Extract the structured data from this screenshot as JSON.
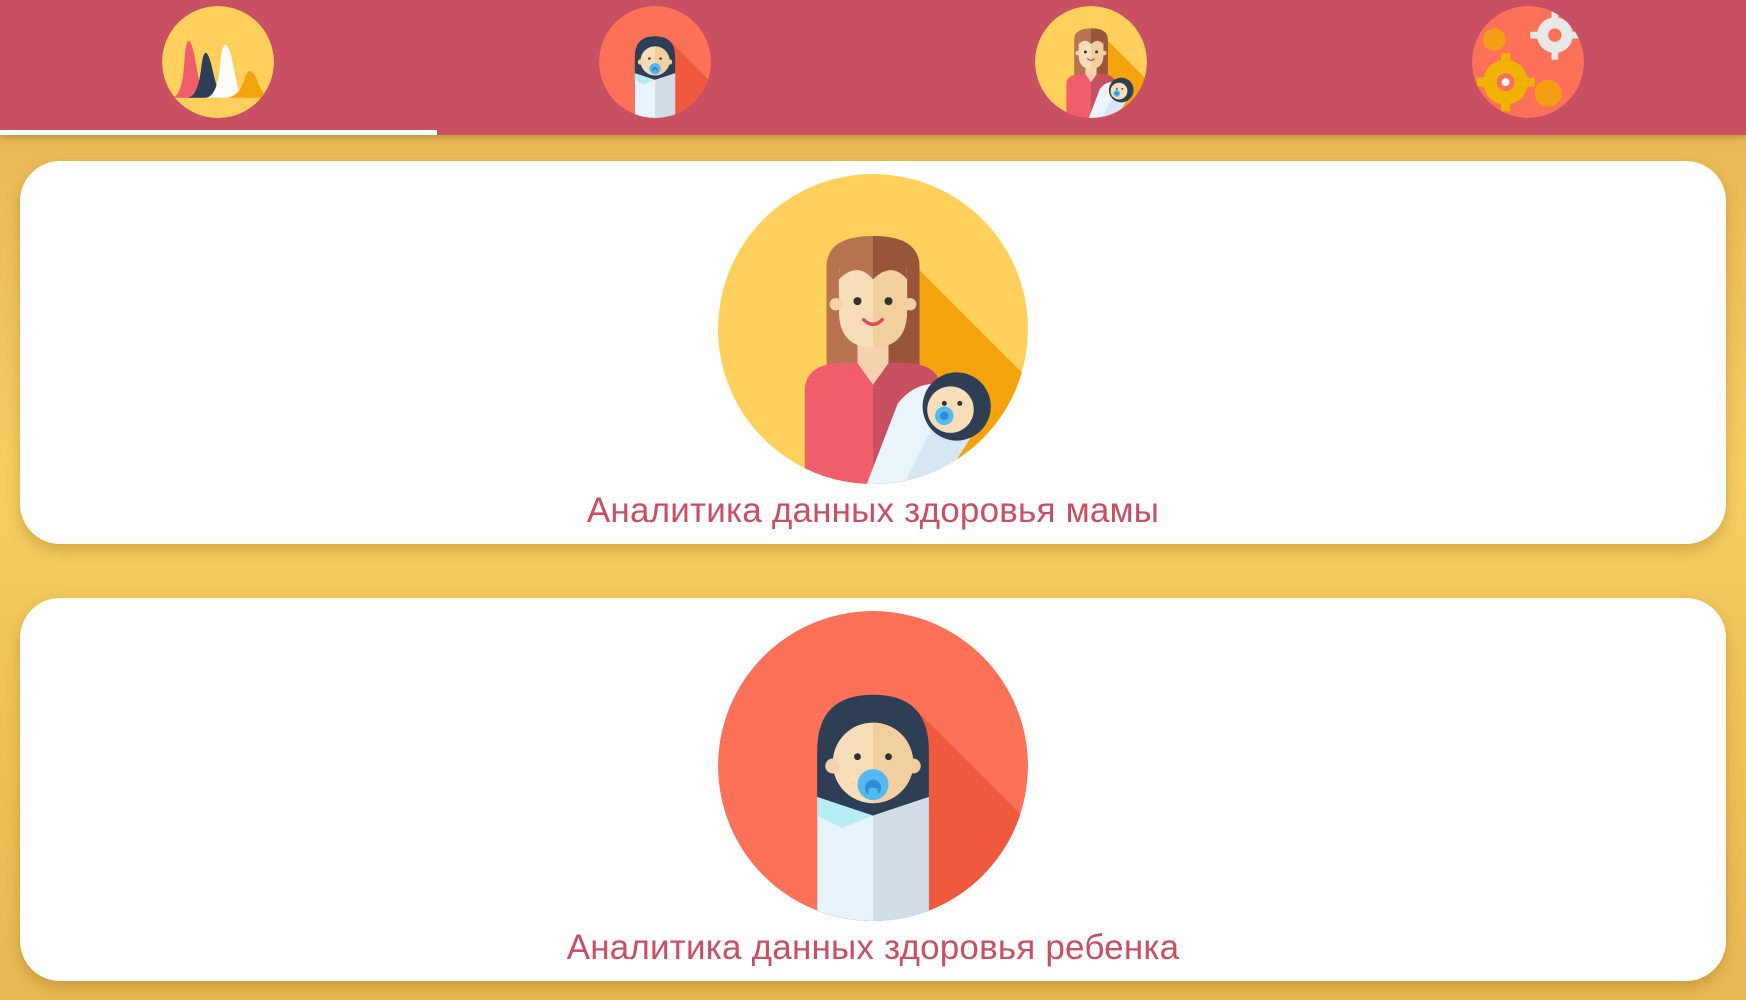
{
  "tabs": [
    {
      "id": "analytics",
      "icon": "analytics-chart-icon",
      "active": true
    },
    {
      "id": "child",
      "icon": "baby-icon",
      "active": false
    },
    {
      "id": "mom",
      "icon": "mother-with-baby-icon",
      "active": false
    },
    {
      "id": "settings",
      "icon": "settings-gears-icon",
      "active": false
    }
  ],
  "cards": {
    "mom": {
      "icon": "mother-with-baby-icon",
      "label": "Аналитика данных здоровья мамы"
    },
    "child": {
      "icon": "baby-icon",
      "label": "Аналитика данных здоровья ребенка"
    }
  },
  "colors": {
    "tabbar": "#c94f63",
    "background": "#f0c75a",
    "label": "#c94f63",
    "indicator": "#ffffff"
  }
}
